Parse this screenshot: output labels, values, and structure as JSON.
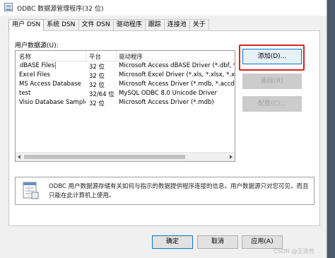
{
  "window": {
    "title": "ODBC 数据源管理程序(32 位)"
  },
  "tabs": [
    {
      "label": "用户 DSN",
      "active": true
    },
    {
      "label": "系统 DSN",
      "active": false
    },
    {
      "label": "文件 DSN",
      "active": false
    },
    {
      "label": "驱动程序",
      "active": false
    },
    {
      "label": "跟踪",
      "active": false
    },
    {
      "label": "连接池",
      "active": false
    },
    {
      "label": "关于",
      "active": false
    }
  ],
  "list": {
    "label": "用户数据源(U):",
    "headers": [
      "名称",
      "平台",
      "驱动程序"
    ],
    "rows": [
      {
        "name": "dBASE Files",
        "platform": "32 位",
        "driver": "Microsoft Access dBASE Driver (*.dbf, *.nd"
      },
      {
        "name": "Excel Files",
        "platform": "32 位",
        "driver": "Microsoft Excel Driver (*.xls, *.xlsx, *.xlsm, *"
      },
      {
        "name": "MS Access Database",
        "platform": "32 位",
        "driver": "Microsoft Access Driver (*.mdb, *.accdb)"
      },
      {
        "name": "test",
        "platform": "32/64 位",
        "driver": "MySQL ODBC 8.0 Unicode Driver"
      },
      {
        "name": "Visio Database Samples",
        "platform": "32 位",
        "driver": "Microsoft Access Driver (*.mdb)"
      }
    ]
  },
  "buttons": {
    "add": "添加(D)...",
    "remove": "删除(R)",
    "configure": "配置(C)..."
  },
  "info": {
    "text": "ODBC 用户数据源存储有关如何与指示的数据提供程序连接的信息。用户数据源只对您可见，而且只能在此计算机上使用。"
  },
  "footer": {
    "ok": "确定",
    "cancel": "取消",
    "apply": "应用(A)",
    "watermark": "CSDN @王流然"
  },
  "colors": {
    "highlight": "#e02020",
    "focus": "#0078d7"
  }
}
